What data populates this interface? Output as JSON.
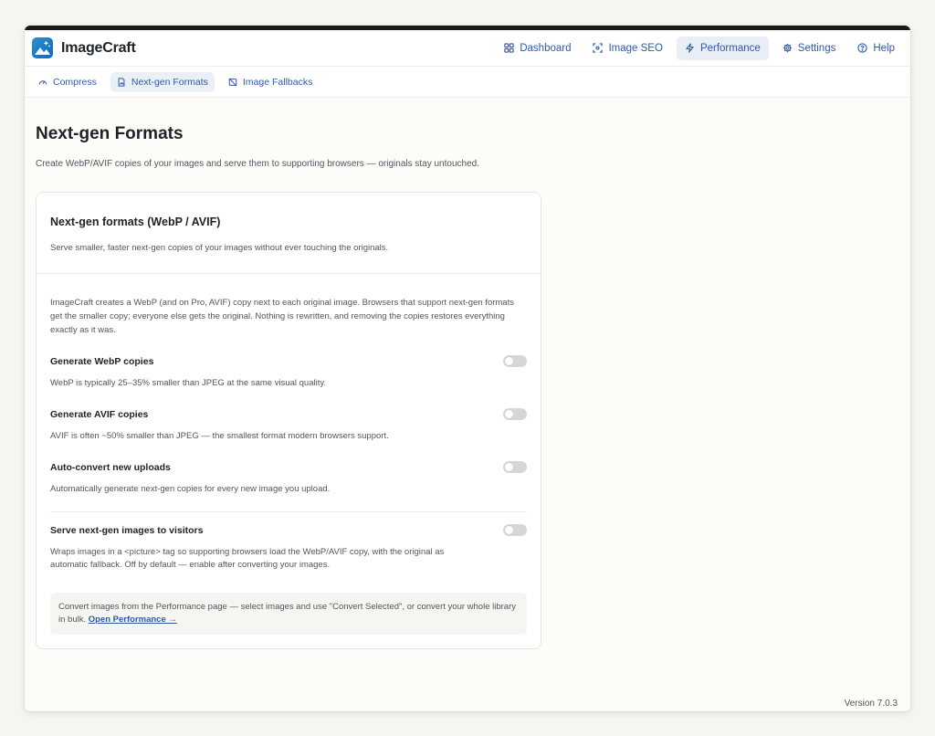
{
  "brand": {
    "name": "ImageCraft"
  },
  "nav": [
    {
      "label": "Dashboard",
      "icon": "grid-icon"
    },
    {
      "label": "Image SEO",
      "icon": "scan-icon"
    },
    {
      "label": "Performance",
      "icon": "lightning-icon",
      "active": true
    },
    {
      "label": "Settings",
      "icon": "gear-icon"
    },
    {
      "label": "Help",
      "icon": "help-circle-icon"
    }
  ],
  "subnav": [
    {
      "label": "Compress",
      "icon": "gauge-icon"
    },
    {
      "label": "Next-gen Formats",
      "icon": "file-image-icon",
      "active": true
    },
    {
      "label": "Image Fallbacks",
      "icon": "image-off-icon"
    }
  ],
  "page": {
    "title": "Next-gen Formats",
    "description": "Create WebP/AVIF copies of your images and serve them to supporting browsers — originals stay untouched."
  },
  "card": {
    "title": "Next-gen formats (WebP / AVIF)",
    "subtitle": "Serve smaller, faster next-gen copies of your images without ever touching the originals.",
    "intro": "ImageCraft creates a WebP (and on Pro, AVIF) copy next to each original image. Browsers that support next-gen formats get the smaller copy; everyone else gets the original. Nothing is rewritten, and removing the copies restores everything exactly as it was.",
    "settings": [
      {
        "label": "Generate WebP copies",
        "description": "WebP is typically 25–35% smaller than JPEG at the same visual quality.",
        "enabled": false
      },
      {
        "label": "Generate AVIF copies",
        "description": "AVIF is often ~50% smaller than JPEG — the smallest format modern browsers support.",
        "enabled": false
      },
      {
        "label": "Auto-convert new uploads",
        "description": "Automatically generate next-gen copies for every new image you upload.",
        "enabled": false
      },
      {
        "label": "Serve next-gen images to visitors",
        "description": "Wraps images in a <picture> tag so supporting browsers load the WebP/AVIF copy, with the original as automatic fallback. Off by default — enable after converting your images.",
        "enabled": false
      }
    ],
    "note": {
      "text": "Convert images from the Performance page — select images and use \"Convert Selected\", or convert your whole library in bulk.",
      "link": "Open Performance →"
    }
  },
  "footer": {
    "version": "Version 7.0.3"
  },
  "colors": {
    "accent": "#2c5aa8",
    "toggle_off": "#d6d6d6",
    "active_nav_bg": "#e9eef6"
  }
}
